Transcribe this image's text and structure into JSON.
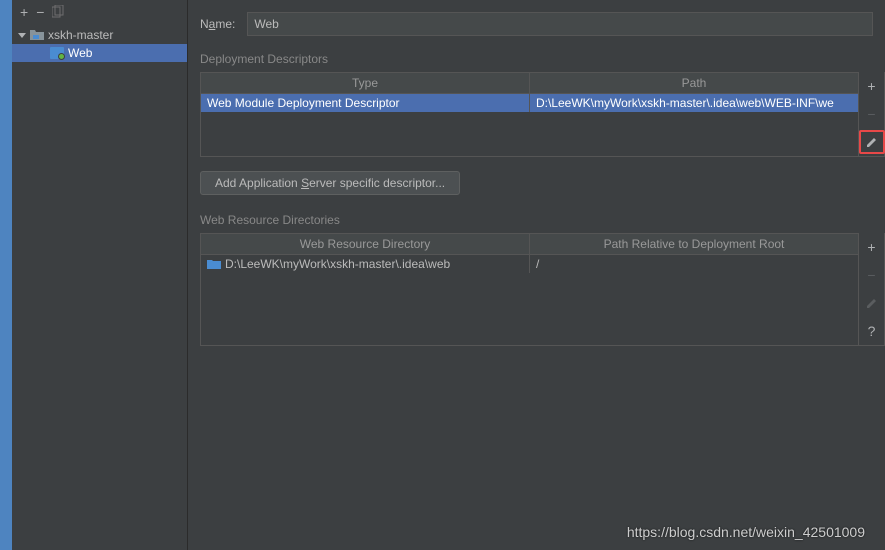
{
  "sidebar": {
    "root": {
      "label": "xskh-master"
    },
    "child": {
      "label": "Web"
    }
  },
  "name": {
    "label": "Name:",
    "value": "Web"
  },
  "descriptors": {
    "section_label": "Deployment Descriptors",
    "headers": {
      "type": "Type",
      "path": "Path"
    },
    "rows": [
      {
        "type": "Web Module Deployment Descriptor",
        "path": "D:\\LeeWK\\myWork\\xskh-master\\.idea\\web\\WEB-INF\\we"
      }
    ],
    "add_btn": "Add Application Server specific descriptor..."
  },
  "resources": {
    "section_label": "Web Resource Directories",
    "headers": {
      "dir": "Web Resource Directory",
      "rel": "Path Relative to Deployment Root"
    },
    "rows": [
      {
        "dir": "D:\\LeeWK\\myWork\\xskh-master\\.idea\\web",
        "rel": "/"
      }
    ]
  },
  "watermark": "https://blog.csdn.net/weixin_42501009"
}
